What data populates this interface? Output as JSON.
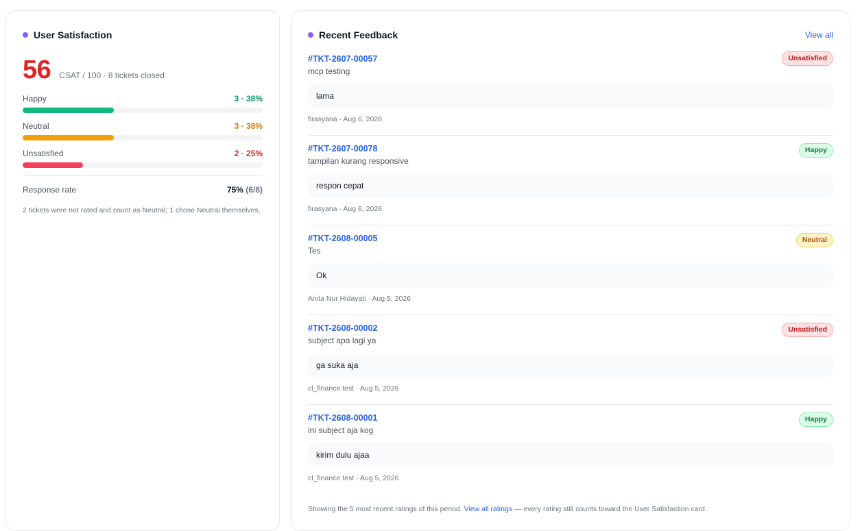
{
  "satisfaction": {
    "title": "User Satisfaction",
    "score": "56",
    "caption": "CSAT / 100 · 8 tickets closed",
    "distribution": [
      {
        "label": "Happy",
        "value": "3 · 38%",
        "fraction": 0.38,
        "color": "#10b981",
        "text_color": "#059669"
      },
      {
        "label": "Neutral",
        "value": "3 · 38%",
        "fraction": 0.38,
        "color": "#f59e0b",
        "text_color": "#d97706"
      },
      {
        "label": "Unsatisfied",
        "value": "2 · 25%",
        "fraction": 0.25,
        "color": "#f43f5e",
        "text_color": "#dc2626"
      }
    ],
    "response_label": "Response rate",
    "response_value": "75%",
    "response_sub": "(6/8)",
    "note": "2 tickets were not rated and count as Neutral; 1 chose Neutral themselves."
  },
  "feedback": {
    "title": "Recent Feedback",
    "view_all": "View all",
    "items": [
      {
        "ticket": "#TKT-2607-00057",
        "subject": "mcp testing",
        "comment": "lama",
        "meta": "firasyana · Aug 6, 2026",
        "rating": "Unsatisfied",
        "rating_class": "unsatisfied"
      },
      {
        "ticket": "#TKT-2607-00078",
        "subject": "tampilan kurang responsive",
        "comment": "respon cepat",
        "meta": "firasyana · Aug 6, 2026",
        "rating": "Happy",
        "rating_class": "happy"
      },
      {
        "ticket": "#TKT-2608-00005",
        "subject": "Tes",
        "comment": "Ok",
        "meta": "Anita Nur Hidayati · Aug 5, 2026",
        "rating": "Neutral",
        "rating_class": "neutral"
      },
      {
        "ticket": "#TKT-2608-00002",
        "subject": "subject apa lagi ya",
        "comment": "ga suka aja",
        "meta": "cl_finance test · Aug 5, 2026",
        "rating": "Unsatisfied",
        "rating_class": "unsatisfied"
      },
      {
        "ticket": "#TKT-2608-00001",
        "subject": "ini subject aja kog",
        "comment": "kirim dulu ajaa",
        "meta": "cl_finance test · Aug 5, 2026",
        "rating": "Happy",
        "rating_class": "happy"
      }
    ],
    "footer_prefix": "Showing the 5 most recent ratings of this period.",
    "footer_link": "View all ratings",
    "footer_suffix": "— every rating still counts toward the User Satisfaction card."
  },
  "colors": {
    "accent_dot": "#8b5cf6",
    "score": "#dc2626",
    "link": "#2563eb"
  }
}
